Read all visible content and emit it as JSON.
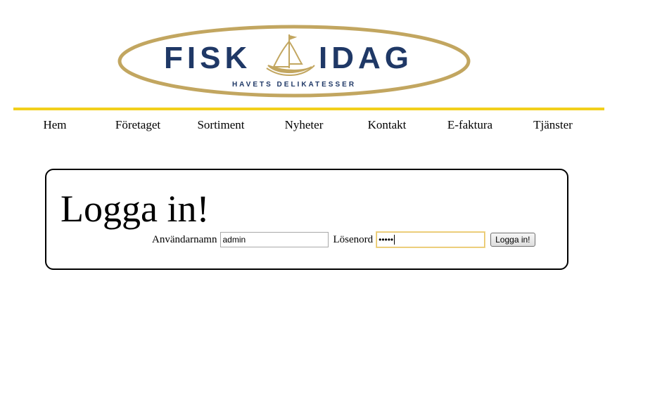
{
  "logo": {
    "word_left": "FISK",
    "word_right": "IDAG",
    "tagline": "HAVETS DELIKATESSER",
    "ring_color": "#c2a660",
    "text_color": "#1f3866"
  },
  "rule_color": "#f2cf1c",
  "nav": {
    "items": [
      {
        "label": "Hem"
      },
      {
        "label": "Företaget"
      },
      {
        "label": "Sortiment"
      },
      {
        "label": "Nyheter"
      },
      {
        "label": "Kontakt"
      },
      {
        "label": "E-faktura"
      },
      {
        "label": "Tjänster"
      }
    ]
  },
  "login": {
    "title": "Logga in!",
    "username_label": "Användarnamn",
    "username_value": "admin",
    "password_label": "Lösenord",
    "password_value": "•••••",
    "submit_label": "Logga in!"
  }
}
